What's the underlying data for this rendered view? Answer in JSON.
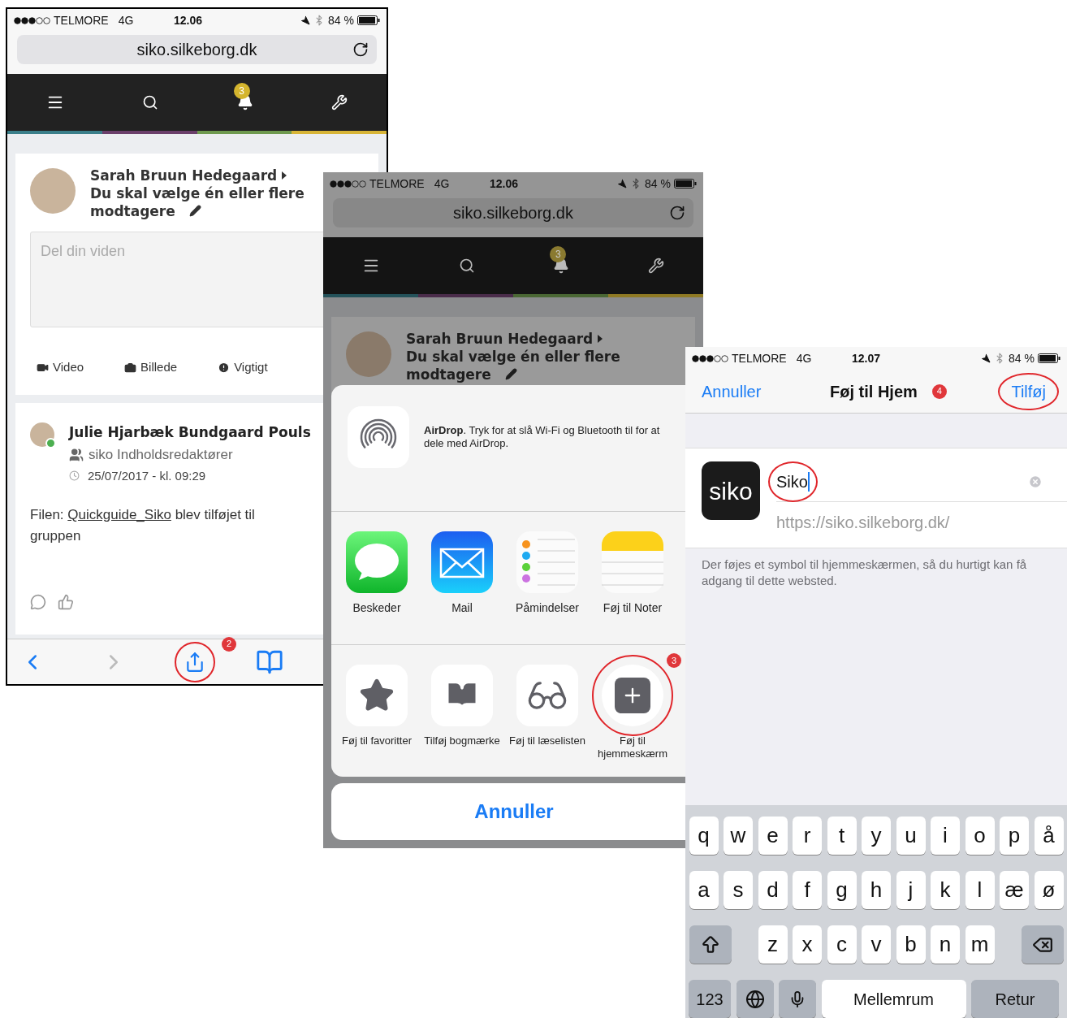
{
  "page_screen": {
    "status_bar": {
      "carrier": "TELMORE",
      "network": "4G",
      "time": "12.06",
      "battery": "84 %"
    },
    "url": "siko.silkeborg.dk",
    "notification_badge": "3",
    "post_form": {
      "author": "Sarah Bruun Hedegaard",
      "recipient": "Du skal vælge én eller flere modtagere",
      "placeholder": "Del din viden",
      "actions": [
        {
          "kind": "video",
          "label": "Video"
        },
        {
          "kind": "photo",
          "label": "Billede"
        },
        {
          "kind": "important",
          "label": "Vigtigt"
        }
      ]
    },
    "feed_item": {
      "author": "Julie Hjarbæk Bundgaard Pouls",
      "online": true,
      "group": "siko Indholdsredaktører",
      "date": "25/07/2017 - kl. 09:29",
      "text_before": "Filen:",
      "link": "Quickguide_Siko",
      "text_after": "blev tilføjet til gruppen"
    },
    "toolbar": {
      "share_highlighted": true,
      "step_badge": "2"
    }
  },
  "share_screen": {
    "dimmed": true,
    "status_bar": {
      "carrier": "TELMORE",
      "network": "4G",
      "time": "12.06",
      "battery": "84 %"
    },
    "url": "siko.silkeborg.dk",
    "notification_badge": "3",
    "post_form": {
      "author": "Sarah Bruun Hedegaard",
      "recipient": "Du skal vælge én eller flere modtagere"
    },
    "airdrop_text": "**AirDrop**. Tryk for at slå Wi-Fi og Bluetooth til for at dele med AirDrop.",
    "apps": [
      {
        "kind": "messages",
        "label": "Beskeder"
      },
      {
        "kind": "mail",
        "label": "Mail"
      },
      {
        "kind": "reminders",
        "label": "Påmindelser"
      },
      {
        "kind": "notes",
        "label": "Føj til Noter"
      }
    ],
    "actions": [
      {
        "kind": "favorite",
        "label": "Føj til favoritter",
        "highlighted": false
      },
      {
        "kind": "bookmark",
        "label": "Tilføj bogmærke",
        "highlighted": false
      },
      {
        "kind": "reading_list",
        "label": "Føj til læselisten",
        "highlighted": false
      },
      {
        "kind": "home_screen",
        "label": "Føj til hjemmeskærm",
        "highlighted": true,
        "step_badge": "3"
      }
    ],
    "cancel": "Annuller"
  },
  "home_screen_dialog": {
    "status_bar": {
      "carrier": "TELMORE",
      "network": "4G",
      "time": "12.07",
      "battery": "84 %"
    },
    "cancel": "Annuller",
    "title": "Føj til Hjem",
    "step_badge": "4",
    "add": "Tilføj",
    "add_highlighted": true,
    "app_icon_text": "siko",
    "name_field": {
      "value": "Siko",
      "highlighted": true
    },
    "url": "https://siko.silkeborg.dk/",
    "description": "Der føjes et symbol til hjemmeskærmen, så du hurtigt kan få adgang til dette websted.",
    "keyboard": {
      "rows": [
        {
          "keys": [
            "q",
            "w",
            "e",
            "r",
            "t",
            "y",
            "u",
            "i",
            "o",
            "p",
            "å"
          ]
        },
        {
          "keys": [
            "a",
            "s",
            "d",
            "f",
            "g",
            "h",
            "j",
            "k",
            "l",
            "æ",
            "ø"
          ]
        },
        {
          "shift": true,
          "keys": [
            "z",
            "x",
            "c",
            "v",
            "b",
            "n",
            "m"
          ],
          "delete": true
        }
      ],
      "bottom": [
        {
          "kind": "key",
          "label": "123"
        },
        {
          "kind": "globe"
        },
        {
          "kind": "mic"
        },
        {
          "kind": "space",
          "label": "Mellemrum"
        },
        {
          "kind": "return",
          "label": "Retur"
        }
      ]
    }
  }
}
